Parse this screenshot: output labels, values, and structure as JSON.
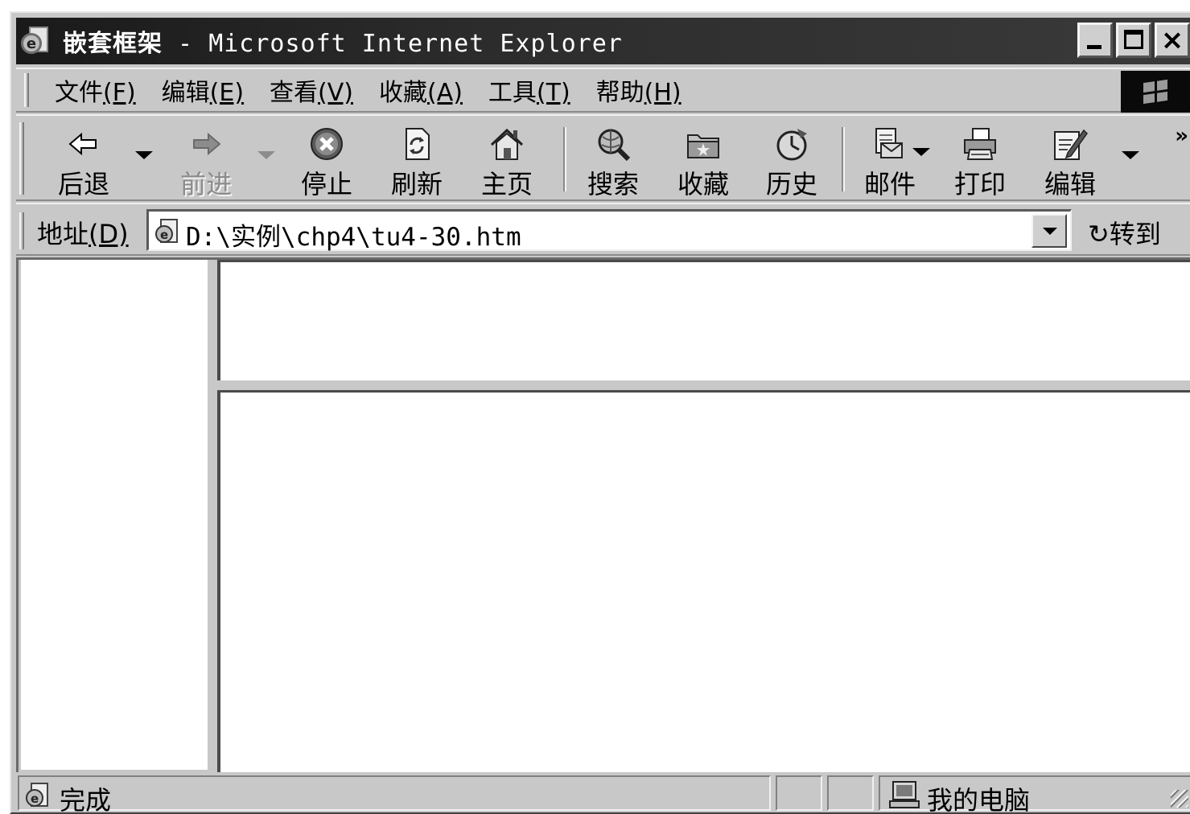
{
  "window": {
    "title_cn": "嵌套框架",
    "title_sep": " - ",
    "title_app": "Microsoft Internet Explorer"
  },
  "menubar": {
    "items": [
      {
        "label": "文件",
        "key": "(F)"
      },
      {
        "label": "编辑",
        "key": "(E)"
      },
      {
        "label": "查看",
        "key": "(V)"
      },
      {
        "label": "收藏",
        "key": "(A)"
      },
      {
        "label": "工具",
        "key": "(T)"
      },
      {
        "label": "帮助",
        "key": "(H)"
      }
    ]
  },
  "toolbar": {
    "back": "后退",
    "forward": "前进",
    "stop": "停止",
    "refresh": "刷新",
    "home": "主页",
    "search": "搜索",
    "favorites": "收藏",
    "history": "历史",
    "mail": "邮件",
    "print": "打印",
    "edit": "编辑",
    "more": "»"
  },
  "address": {
    "label": "地址",
    "key": "(D)",
    "value": "D:\\实例\\chp4\\tu4-30.htm",
    "go": "转到",
    "go_icon": "↻"
  },
  "status": {
    "text": "完成",
    "zone": "我的电脑"
  },
  "icons": {
    "app": "ie-page-icon",
    "back": "back-arrow-icon",
    "forward": "forward-arrow-icon",
    "stop": "stop-icon",
    "refresh": "refresh-icon",
    "home": "home-icon",
    "search": "search-globe-icon",
    "favorites": "favorites-folder-icon",
    "history": "history-icon",
    "mail": "mail-icon",
    "print": "printer-icon",
    "edit": "edit-icon"
  }
}
